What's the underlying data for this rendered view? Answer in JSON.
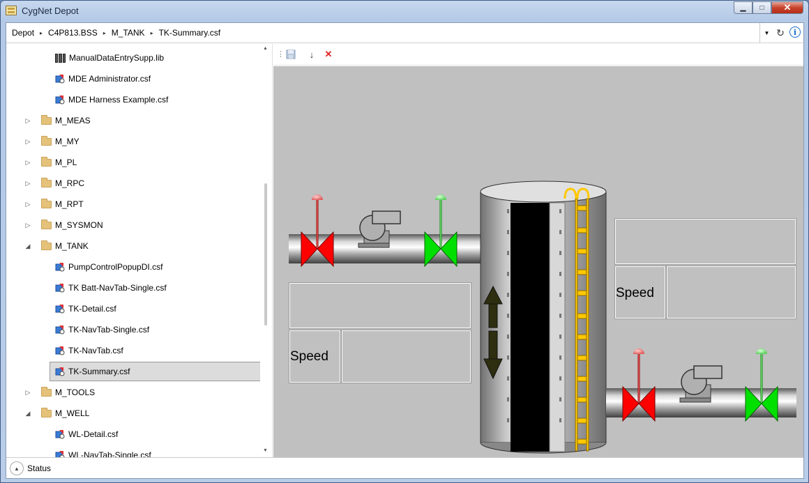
{
  "window": {
    "title": "CygNet Depot"
  },
  "window_buttons": {
    "minimize": "▁",
    "maximize": "□",
    "close": "✕"
  },
  "breadcrumb": [
    "Depot",
    "C4P813.BSS",
    "M_TANK",
    "TK-Summary.csf"
  ],
  "tree": [
    {
      "label": "ManualDataEntrySupp.lib",
      "type": "lib",
      "level": 2
    },
    {
      "label": "MDE Administrator.csf",
      "type": "csf",
      "level": 2
    },
    {
      "label": "MDE Harness Example.csf",
      "type": "csf",
      "level": 2
    },
    {
      "label": "M_MEAS",
      "type": "folder",
      "level": 1,
      "expanded": false
    },
    {
      "label": "M_MY",
      "type": "folder",
      "level": 1,
      "expanded": false
    },
    {
      "label": "M_PL",
      "type": "folder",
      "level": 1,
      "expanded": false
    },
    {
      "label": "M_RPC",
      "type": "folder",
      "level": 1,
      "expanded": false
    },
    {
      "label": "M_RPT",
      "type": "folder",
      "level": 1,
      "expanded": false
    },
    {
      "label": "M_SYSMON",
      "type": "folder",
      "level": 1,
      "expanded": false
    },
    {
      "label": "M_TANK",
      "type": "folder",
      "level": 1,
      "expanded": true
    },
    {
      "label": "PumpControlPopupDI.csf",
      "type": "csf",
      "level": 2
    },
    {
      "label": "TK Batt-NavTab-Single.csf",
      "type": "csf",
      "level": 2
    },
    {
      "label": "TK-Detail.csf",
      "type": "csf",
      "level": 2
    },
    {
      "label": "TK-NavTab-Single.csf",
      "type": "csf",
      "level": 2
    },
    {
      "label": "TK-NavTab.csf",
      "type": "csf",
      "level": 2
    },
    {
      "label": "TK-Summary.csf",
      "type": "csf",
      "level": 2,
      "selected": true
    },
    {
      "label": "M_TOOLS",
      "type": "folder",
      "level": 1,
      "expanded": false
    },
    {
      "label": "M_WELL",
      "type": "folder",
      "level": 1,
      "expanded": true
    },
    {
      "label": "WL-Detail.csf",
      "type": "csf",
      "level": 2
    },
    {
      "label": "WL-NavTab-Single.csf",
      "type": "csf",
      "level": 2
    }
  ],
  "canvas": {
    "left_speed_label": "Speed",
    "right_speed_label": "Speed"
  },
  "statusbar": {
    "label": "Status"
  },
  "colors": {
    "valve_red": "#ff0000",
    "valve_green": "#00e000",
    "ladder": "#ffc800",
    "canvas_bg": "#c0c0c0"
  }
}
